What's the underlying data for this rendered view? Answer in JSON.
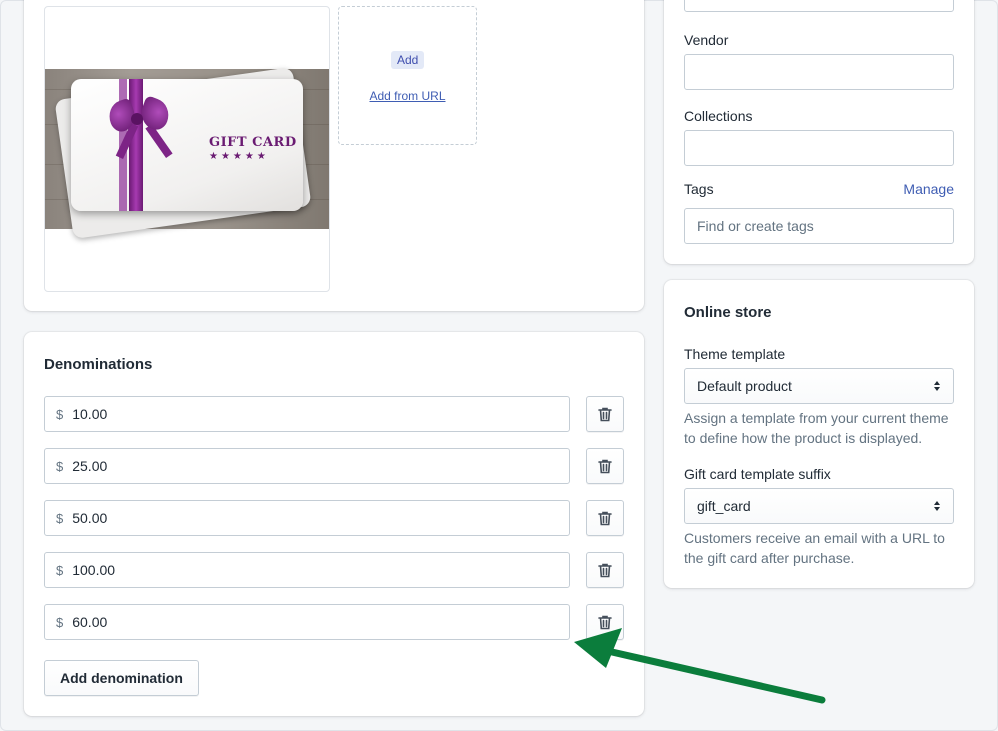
{
  "media": {
    "image_text": "GIFT CARD",
    "add_label": "Add",
    "add_from_url_label": "Add from URL"
  },
  "denominations": {
    "title": "Denominations",
    "currency_symbol": "$",
    "values": [
      "10.00",
      "25.00",
      "50.00",
      "100.00",
      "60.00"
    ],
    "add_button_label": "Add denomination",
    "delete_icon": "trash-icon"
  },
  "organization": {
    "vendor_label": "Vendor",
    "vendor_value": "",
    "collections_label": "Collections",
    "collections_value": "",
    "tags_label": "Tags",
    "manage_label": "Manage",
    "tags_placeholder": "Find or create tags"
  },
  "online_store": {
    "title": "Online store",
    "theme_template_label": "Theme template",
    "theme_template_value": "Default product",
    "theme_template_help": "Assign a template from your current theme to define how the product is displayed.",
    "suffix_label": "Gift card template suffix",
    "suffix_value": "gift_card",
    "suffix_help": "Customers receive an email with a URL to the gift card after purchase."
  },
  "annotation": {
    "arrow_color": "#0b7d3c"
  }
}
